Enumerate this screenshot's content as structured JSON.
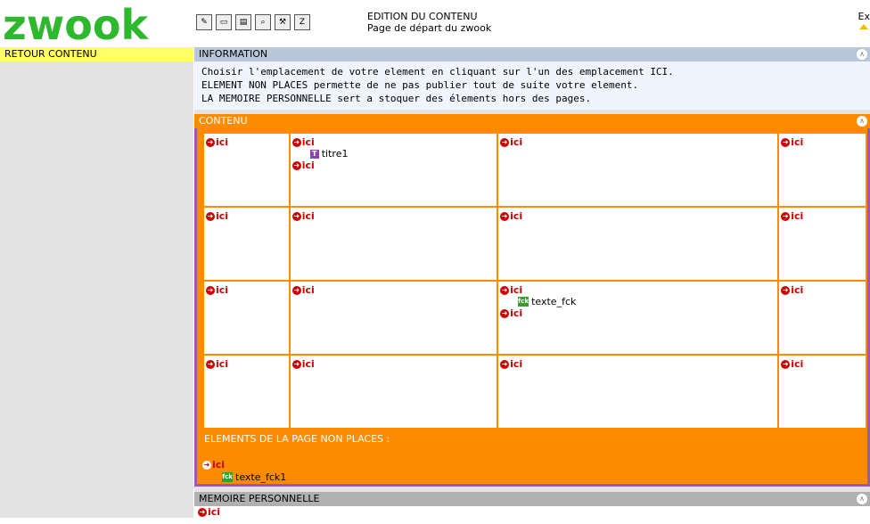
{
  "brand": {
    "logo_text": "zwook",
    "logo_color": "#2db82d"
  },
  "toolbar": {
    "buttons": [
      {
        "icon": "edit-icon"
      },
      {
        "icon": "page-icon"
      },
      {
        "icon": "layout-icon"
      },
      {
        "icon": "search-icon"
      },
      {
        "icon": "tools-icon"
      },
      {
        "icon": "zoom-icon"
      }
    ]
  },
  "header": {
    "title": "EDITION DU CONTENU",
    "subtitle": "Page de départ du zwook",
    "exit_label": "Ex"
  },
  "sidebar": {
    "back_label": "RETOUR CONTENU"
  },
  "information": {
    "title": "INFORMATION",
    "lines": [
      "Choisir l'emplacement de votre element en cliquant sur l'un des emplacement ICI.",
      "ELEMENT NON PLACES permette de ne pas publier tout de suite votre element.",
      "LA MEMOIRE PERSONNELLE sert a stoquer des élements hors des pages."
    ]
  },
  "contenu": {
    "title": "CONTENU",
    "ici_label": "ici",
    "grid": [
      [
        {
          "items": []
        },
        {
          "items": [
            {
              "type": "titre",
              "icon": "T",
              "label": "titre1"
            }
          ]
        },
        {
          "items": []
        },
        {
          "items": []
        }
      ],
      [
        {
          "items": []
        },
        {
          "items": []
        },
        {
          "items": []
        },
        {
          "items": []
        }
      ],
      [
        {
          "items": []
        },
        {
          "items": []
        },
        {
          "items": [
            {
              "type": "fck",
              "icon": "fck",
              "label": "texte_fck"
            }
          ]
        },
        {
          "items": []
        }
      ],
      [
        {
          "items": []
        },
        {
          "items": []
        },
        {
          "items": []
        },
        {
          "items": []
        }
      ]
    ],
    "non_places_title": "ELEMENTS DE LA PAGE NON PLACES :",
    "non_places_items": [
      {
        "icon": "fck",
        "label": "texte_fck1"
      }
    ]
  },
  "memoire": {
    "title": "MEMOIRE PERSONNELLE"
  },
  "colors": {
    "orange": "#ff8c00",
    "purple": "#9b59b6",
    "ici_red": "#cc0000",
    "retour_yellow": "#ffff66"
  }
}
